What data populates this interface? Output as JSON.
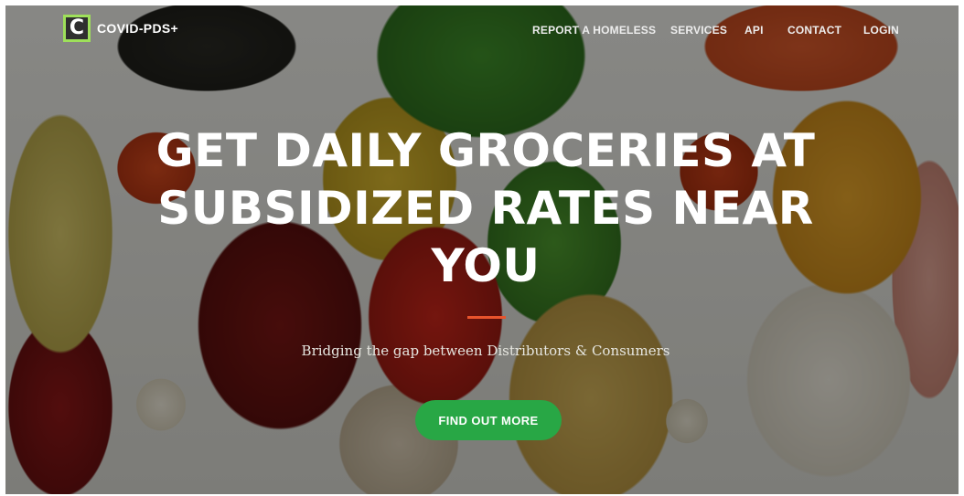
{
  "navbar": {
    "brand": {
      "logo_letter": "C",
      "name": "COVID-PDS+"
    },
    "links": [
      {
        "label": "REPORT A HOMELESS"
      },
      {
        "label": "SERVICES"
      },
      {
        "label": "API"
      },
      {
        "label": "CONTACT"
      },
      {
        "label": "LOGIN"
      }
    ]
  },
  "hero": {
    "title": "GET DAILY GROCERIES AT SUBSIDIZED RATES NEAR YOU",
    "subtitle": "Bridging the gap between Distributors & Consumers",
    "cta_label": "FIND OUT MORE"
  },
  "colors": {
    "accent_green": "#28a745",
    "logo_border": "#9ee05a",
    "divider_orange": "#e8542c"
  }
}
